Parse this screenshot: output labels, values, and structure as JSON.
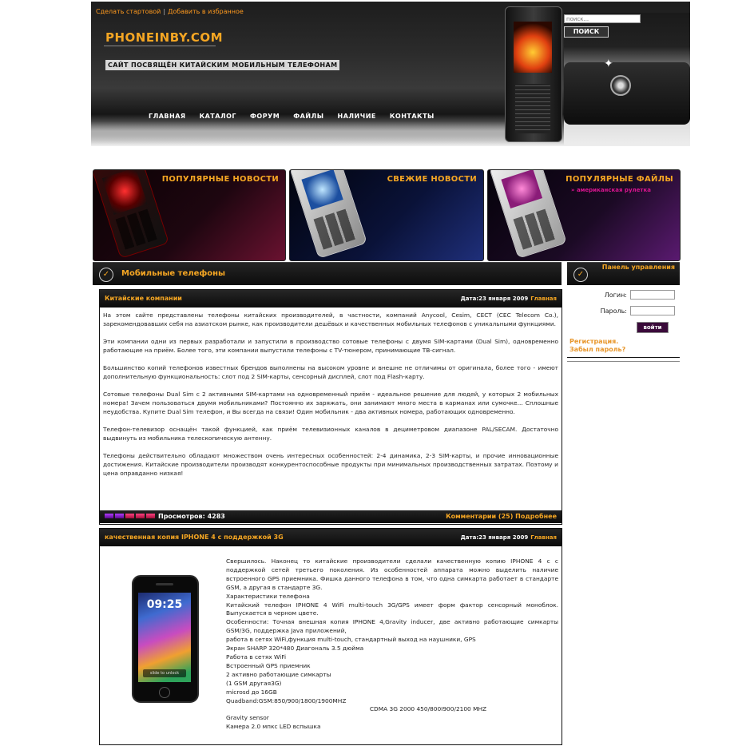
{
  "header": {
    "top_links": [
      "Сделать стартовой",
      "Добавить в избранное"
    ],
    "top_links_separator": "|",
    "site_title": "PHONEINBY.COM",
    "tagline": "САЙТ ПОСВЯЩЁН КИТАЙСКИМ МОБИЛЬНЫМ ТЕЛЕФОНАМ",
    "nav": [
      "ГЛАВНАЯ",
      "КАТАЛОГ",
      "ФОРУМ",
      "ФАЙЛЫ",
      "НАЛИЧИЕ",
      "КОНТАКТЫ"
    ],
    "search_placeholder": "поиск...",
    "search_button": "ПОИСК"
  },
  "promos": [
    {
      "title": "ПОПУЛЯРНЫЕ НОВОСТИ",
      "sub": ""
    },
    {
      "title": "СВЕЖИЕ НОВОСТИ",
      "sub": ""
    },
    {
      "title": "ПОПУЛЯРНЫЕ ФАЙЛЫ",
      "sub": "» американская рулетка"
    }
  ],
  "main_section": {
    "title": "Мобильные телефоны",
    "tick": "✓"
  },
  "side_section": {
    "title": "Панель управления",
    "tick": "✓"
  },
  "articles": [
    {
      "title": "Китайские компании",
      "date_label": "Дата:",
      "date": "23 января 2009",
      "category": "Главная",
      "paragraphs": [
        "На этом сайте представлены телефоны китайских производителей, в частности, компаний Anycool, Cesim, CECT (CEC Telecom Co.), зарекомендовавших себя на азиатском рынке, как производители дешёвых и качественных мобильных телефонов с уникальными функциями.",
        "Эти компании одни из первых разработали и запустили в производство сотовые телефоны с двумя SIM-картами (Dual Sim), одновременно работающие на приём. Более того, эти компании выпустили телефоны с TV-тюнером, принимающие ТВ-сигнал.",
        "Большинство копий телефонов известных брендов выполнены на высоком уровне и внешне не отличимы от оригинала, более того - имеют дополнительную функциональность: слот под 2 SIM-карты, сенсорный дисплей, слот под Flash-карту.",
        "Сотовые телефоны Dual Sim с 2 активными SIM-картами на одновременный приём - идеальное решение для людей, у которых 2 мобильных номера! Зачем пользоваться двумя мобильниками? Постоянно их заряжать, они занимают много места в карманах или сумочке... Сплошные неудобства. Купите Dual Sim телефон, и Вы всегда на связи! Один мобильник - два активных номера, работающих одновременно.",
        "Телефон-телевизор оснащён такой функцией, как приём телевизионных каналов в дециметровом диапазоне PAL/SECAM. Достаточно выдвинуть из мобильника телескопическую антенну.",
        "Телефоны действительно обладают множеством очень интересных особенностей: 2-4 динамика, 2-3 SIM-карты, и прочие инновационные достижения. Китайские производители производят конкурентоспособные продукты при минимальных производственных затратах. Поэтому и цена оправданно низкая!"
      ],
      "views": "Просмотров:  4283",
      "footer_links": "Комментарии (25) Подробнее"
    },
    {
      "title": "качественная копия IPHONE 4 с поддержкой 3G",
      "date_label": "Дата:",
      "date": "23 января 2009",
      "category": "Главная",
      "image": {
        "clock": "09:25",
        "slide": "slide to unlock"
      },
      "lines": [
        "Свершилось. Наконец то китайские производители сделали качественную копию IPHONE 4 с с поддержкой сетей третьего поколения. Из особенностей аппарата можно выделить наличие встроенного GPS приемника. Фишка данного телефона в том, что одна симкарта работает в стандарте GSM, а другая в стандарте 3G.",
        " Характеристики телефона",
        "Китайский телефон IPHONE 4 WiFi multi-touch 3G/GPS имеет форм фактор сенсорный моноблок. Выпускается в черном цвете.",
        "Особенности: Точная внешная копия IPHONE 4,Gravity inducer, две активно работающие симкарты GSM/3G, поддержка Java приложений,",
        "работа в сетях WiFi,функция multi-touch, стандартный выход на наушники, GPS",
        "Экран SHARP 320*480 Диагональ 3.5 дюйма",
        "Работа в сетях WiFi",
        "Встроенный GPS приемник",
        "2 активно работающие симкарты",
        "(1 GSM другая3G)",
        "microsd до 16GB",
        "Quadband:GSM:850/900/1800/1900MHZ",
        "CDMA 3G 2000 450/800I900/2100 MHZ",
        " Gravity sensor",
        " Камера 2.0 мпкс LED вспышка"
      ]
    }
  ],
  "login": {
    "login_label": "Логин:",
    "password_label": "Пароль:",
    "button": "войти",
    "register": "Регистрация.",
    "forgot": "Забыл пароль?"
  },
  "colors": {
    "accent": "#f5a623",
    "link_pink": "#d9148f",
    "dark": "#111111"
  }
}
